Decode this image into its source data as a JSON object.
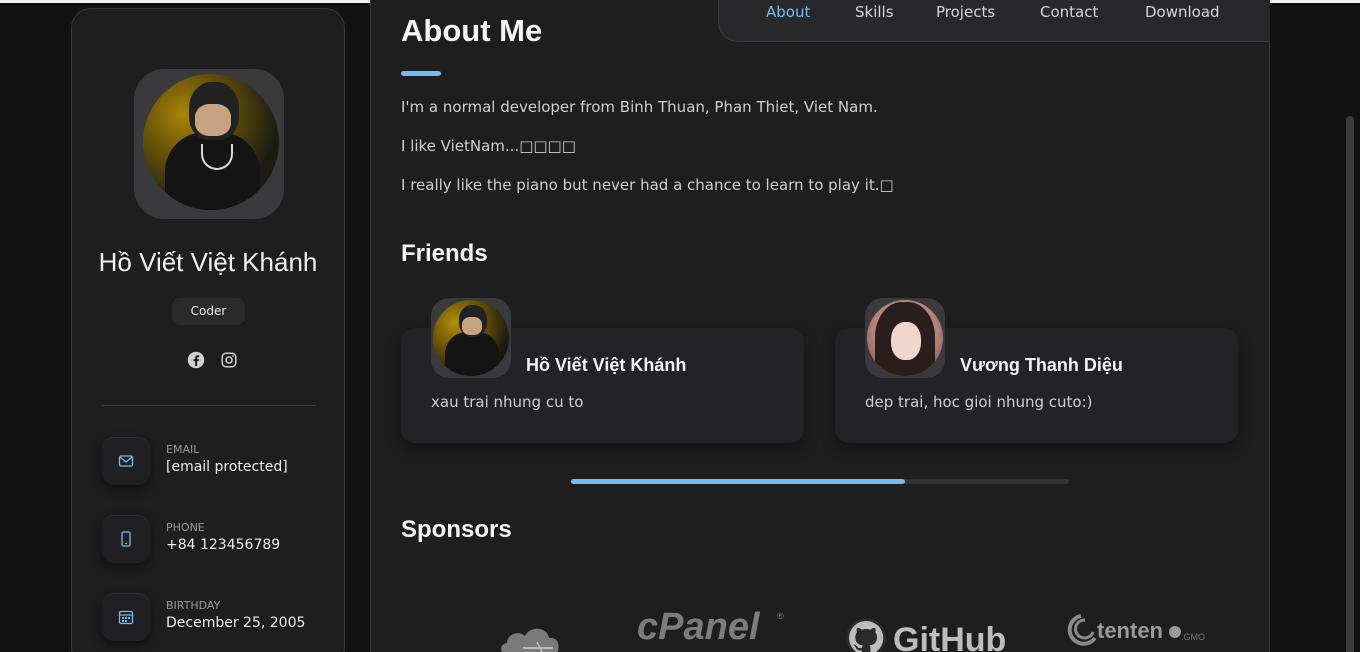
{
  "sidebar": {
    "name": "Hồ Viết Việt Khánh",
    "role": "Coder",
    "social": [
      {
        "icon": "facebook-icon"
      },
      {
        "icon": "instagram-icon"
      }
    ],
    "contacts": [
      {
        "label": "Email",
        "value": "[email protected]",
        "icon": "mail-icon"
      },
      {
        "label": "Phone",
        "value": "+84 123456789",
        "icon": "phone-icon"
      },
      {
        "label": "Birthday",
        "value": "December 25, 2005",
        "icon": "calendar-icon"
      }
    ]
  },
  "nav": {
    "items": [
      "About",
      "Skills",
      "Projects",
      "Contact",
      "Download"
    ],
    "active": "About"
  },
  "about": {
    "title": "About Me",
    "paragraphs": [
      "I'm a normal developer from Binh Thuan, Phan Thiet, Viet Nam.",
      "I like VietNam...□□□□",
      "I really like the piano but never had a chance to learn to play it.□"
    ]
  },
  "friends": {
    "title": "Friends",
    "items": [
      {
        "name": "Hồ Viết Việt Khánh",
        "desc": "xau trai nhung cu to"
      },
      {
        "name": "Vương Thanh Diệu",
        "desc": "dep trai, hoc gioi nhung cuto:)"
      }
    ],
    "scroll_progress": 0.67
  },
  "sponsors": {
    "title": "Sponsors",
    "items": [
      "cloudflare-logo",
      "cPanel",
      "GitHub",
      "tenten"
    ]
  },
  "colors": {
    "accent": "#6fbdf2",
    "background": "#121212",
    "card": "#1e1e1f"
  }
}
